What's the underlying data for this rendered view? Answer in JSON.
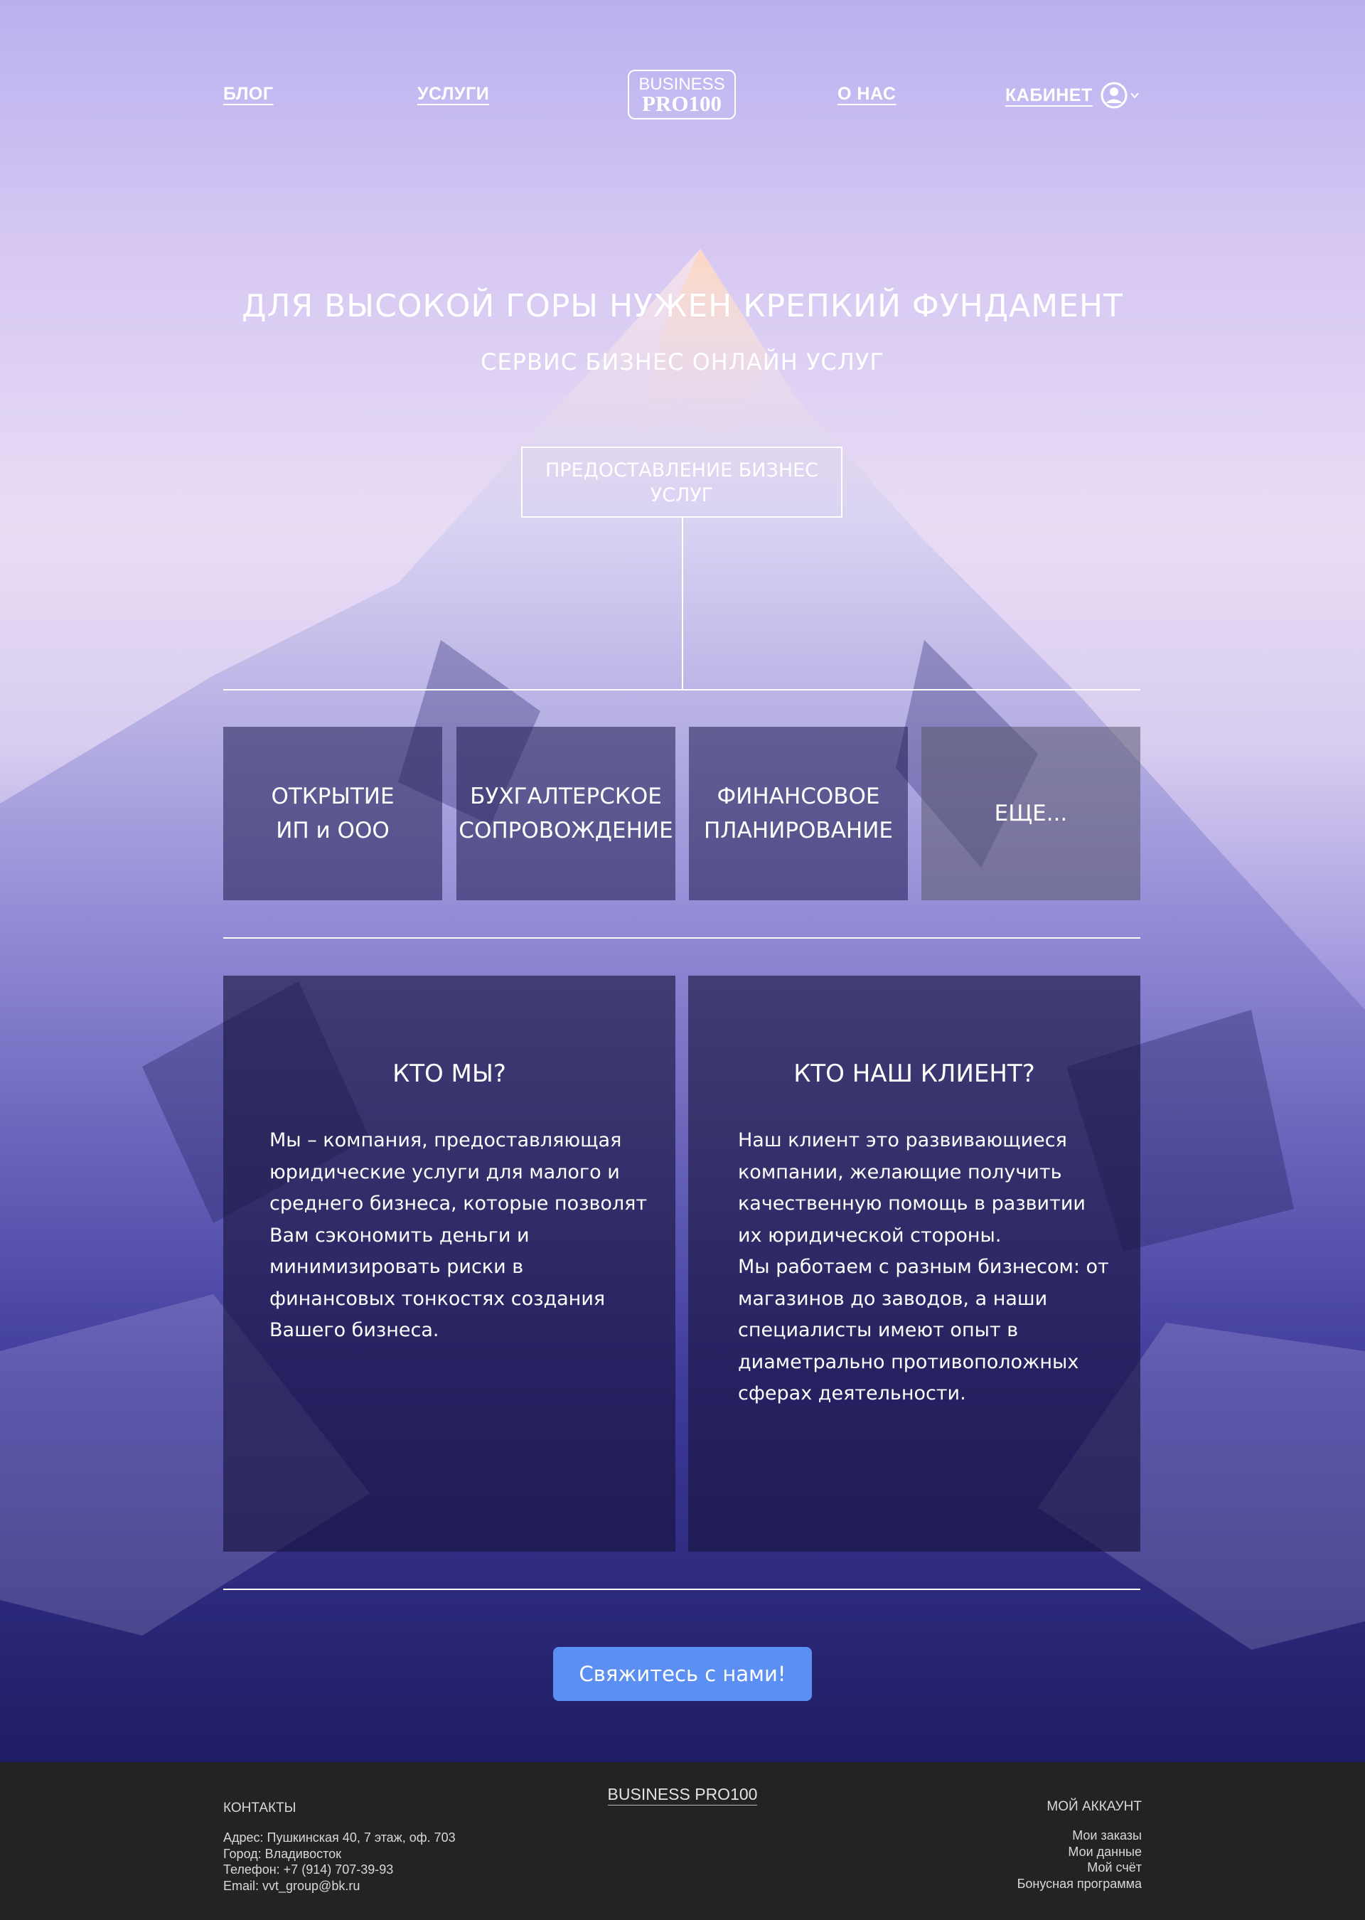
{
  "nav": {
    "blog": "БЛОГ",
    "services": "УСЛУГИ",
    "about": "О НАС",
    "cabinet": "КАБИНЕТ",
    "logo_line1": "BUSINESS",
    "logo_line2": "PRO100"
  },
  "hero": {
    "headline": "ДЛЯ ВЫСОКОЙ ГОРЫ НУЖЕН КРЕПКИЙ ФУНДАМЕНТ",
    "subline": "СЕРВИС БИЗНЕС ОНЛАЙН УСЛУГ",
    "service_box": "ПРЕДОСТАВЛЕНИЕ БИЗНЕС УСЛУГ"
  },
  "cards": [
    {
      "line1": "ОТКРЫТИЕ",
      "line2": "ИП и ООО"
    },
    {
      "line1": "БУХГАЛТЕРСКОЕ",
      "line2": "СОПРОВОЖДЕНИЕ"
    },
    {
      "line1": "ФИНАНСОВОЕ",
      "line2": "ПЛАНИРОВАНИЕ"
    },
    {
      "line1": "ЕЩЕ...",
      "line2": ""
    }
  ],
  "panels": {
    "who": {
      "title": "КТО МЫ?",
      "text": "Мы – компания, предоставляющая\nюридические услуги для малого и\nсреднего бизнеса, которые позволят\nВам сэкономить деньги и\nминимизировать риски в\nфинансовых тонкостях создания\nВашего бизнеса."
    },
    "client": {
      "title": "КТО НАШ КЛИЕНТ?",
      "text": "Наш клиент это развивающиеся\nкомпании, желающие получить\nкачественную помощь в развитии\nих юридической стороны.\nМы работаем с разным бизнесом: от\nмагазинов до заводов, а наши\nспециалисты имеют опыт в\nдиаметрально противоположных\nсферах деятельности."
    }
  },
  "cta": "Свяжитесь с нами!",
  "footer": {
    "contacts_title": "КОНТАКТЫ",
    "brand": "BUSINESS PRO100",
    "account_title": "МОЙ АККАУНТ",
    "address": "Адрес: Пушкинская 40, 7 этаж, оф. 703",
    "city": "Город: Владивосток",
    "phone": "Телефон: +7 (914) 707-39-93",
    "email": "Email: vvt_group@bk.ru",
    "links": [
      "Мои заказы",
      "Мои данные",
      "Мой счёт",
      "Бонусная программа"
    ]
  },
  "colors": {
    "cta": "#5b8ff2",
    "footer_bg": "#232323"
  }
}
